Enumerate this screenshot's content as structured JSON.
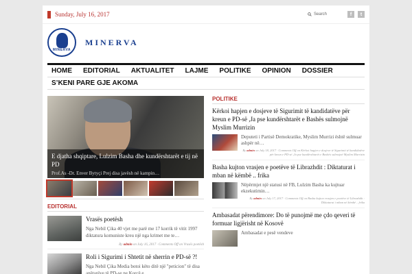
{
  "header": {
    "date": "Sunday, July 16, 2017",
    "search_label": "Search",
    "social": [
      {
        "name": "facebook-icon",
        "glyph": "f"
      },
      {
        "name": "twitter-icon",
        "glyph": "t"
      }
    ]
  },
  "brand": {
    "logo_text": "MINERVA",
    "site_name": "MINERVA"
  },
  "nav": {
    "row1": [
      "HOME",
      "EDITORIAL",
      "AKTUALITET",
      "LAJME",
      "POLITIKE",
      "OPINION",
      "DOSSIER"
    ],
    "row2": [
      "S’KENI PARE GJE AKOMA"
    ]
  },
  "slider": {
    "title": "E djatha shqiptare, Lulzim Basha dhe kundërshtarët e tij në PD",
    "excerpt": "Prof.As -Dr. Enver Bytyçi Prej disa javësh në kampin…"
  },
  "editorial": {
    "section_title": "EDITORIAL",
    "items": [
      {
        "title": "Vrasës poetësh",
        "excerpt": "Nga Nebil Çika 40 vjet me parë me 17 korrik të vitit 1997 diktatura komuniste kreu një nga krimet me te…",
        "meta_prefix": "By",
        "meta_author": "admin",
        "meta_rest": "on July 16, 2017 · Comments Off on Vrasës poetësh"
      },
      {
        "title": "Roli i Sigurimi i Shtetit në sherrin e PD-së ?!",
        "excerpt": "Nga Nebil Çika Media botoi këto ditë një \"peticion\" të disa anëtarëve të PD-se ne Korçë e…",
        "meta_prefix": "",
        "meta_author": "",
        "meta_rest": ""
      }
    ]
  },
  "politike": {
    "section_title": "POLITIKE",
    "items": [
      {
        "title": "Kërkoi hapjen e dosjeve të Sigurimit të kandidatëve për kreun e PD-së ,Ja pse kundërshtarët e Bashës sulmojnë Myslim Murrizin",
        "excerpt": "Deputeti i Partisë Demokratike, Myslim Murrizi është sulmuar ashpër në…",
        "meta_prefix": "By",
        "meta_author": "admin",
        "meta_rest": "on July 18, 2017 · Comments Off on Kërkoi hapjen e dosjeve të Sigurimit të kandidatëve për kreun e PD-së ,Ja pse kundërshtarët e Bashës sulmojnë Myslim Murrizin"
      },
      {
        "title": "Basha kujton vrasjen e poetëve të Librazhdit : Diktaturat i mban në këmbë .. frika",
        "excerpt": "Nëpërmjet një statusi në FB, Lulzim Basha ka kujtuar ekzekutimin…",
        "meta_prefix": "By",
        "meta_author": "admin",
        "meta_rest": "on July 17, 2017 · Comments Off on Basha kujton vrasjen e poetëve të Librazhdit : Diktaturat i mban në këmbë .. frika"
      },
      {
        "title": "Ambasadat përendimore: Do të punojmë me çdo qeveri të formuar ligjërisht në Kosovë",
        "excerpt": "Ambasadat e pesë vendeve",
        "meta_prefix": "",
        "meta_author": "",
        "meta_rest": ""
      }
    ]
  },
  "colors": {
    "accent": "#b8312f",
    "nav_border": "#111111",
    "logo_blue": "#1a3f8f"
  }
}
